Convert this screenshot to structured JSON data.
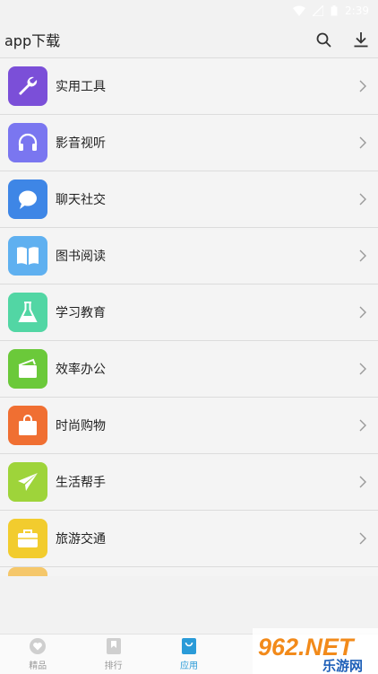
{
  "status_bar": {
    "time": "2:39"
  },
  "header": {
    "title": "app下载"
  },
  "categories": [
    {
      "label": "实用工具",
      "icon": "wrench-icon",
      "color": "#7b4fd8"
    },
    {
      "label": "影音视听",
      "icon": "headphones-icon",
      "color": "#7a76f0"
    },
    {
      "label": "聊天社交",
      "icon": "chat-bubble-icon",
      "color": "#3e86e6"
    },
    {
      "label": "图书阅读",
      "icon": "book-icon",
      "color": "#5fb0f0"
    },
    {
      "label": "学习教育",
      "icon": "flask-icon",
      "color": "#52d6a4"
    },
    {
      "label": "效率办公",
      "icon": "wallet-icon",
      "color": "#6bc93a"
    },
    {
      "label": "时尚购物",
      "icon": "shopping-bag-icon",
      "color": "#f06f32"
    },
    {
      "label": "生活帮手",
      "icon": "paper-plane-icon",
      "color": "#9ed43a"
    },
    {
      "label": "旅游交通",
      "icon": "suitcase-icon",
      "color": "#f2cc2e"
    }
  ],
  "tabs": [
    {
      "label": "精品",
      "icon": "heart-icon"
    },
    {
      "label": "排行",
      "icon": "bookmark-icon"
    },
    {
      "label": "应用",
      "icon": "bag-icon",
      "active": true
    },
    {
      "label": "",
      "icon": ""
    },
    {
      "label": "",
      "icon": ""
    }
  ],
  "watermark": {
    "text": "962.NET",
    "subtext": "乐游网"
  },
  "colors": {
    "accent": "#2a9bd8"
  }
}
